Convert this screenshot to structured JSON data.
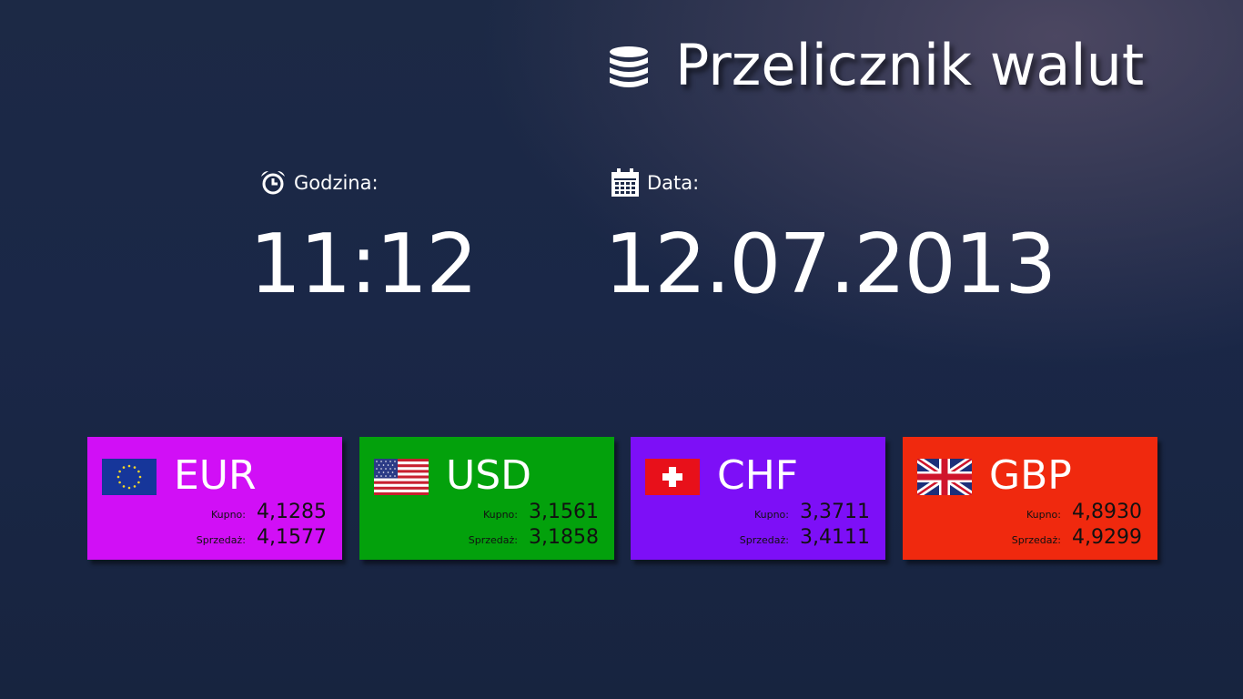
{
  "app": {
    "title": "Przelicznik walut",
    "title_icon": "database-icon"
  },
  "clock": {
    "label": "Godzina:",
    "icon": "alarm-clock-icon",
    "value": "11:12"
  },
  "calendar": {
    "label": "Data:",
    "icon": "calendar-icon",
    "value": "12.07.2013"
  },
  "currencies": [
    {
      "code": "EUR",
      "flag_icon": "eu-flag-icon",
      "color": "#d10ff6",
      "buy_label": "Kupno:",
      "buy": "4,1285",
      "sell_label": "Sprzedaż:",
      "sell": "4,1577"
    },
    {
      "code": "USD",
      "flag_icon": "us-flag-icon",
      "color": "#03a10c",
      "buy_label": "Kupno:",
      "buy": "3,1561",
      "sell_label": "Sprzedaż:",
      "sell": "3,1858"
    },
    {
      "code": "CHF",
      "flag_icon": "swiss-flag-icon",
      "color": "#7d0ff7",
      "buy_label": "Kupno:",
      "buy": "3,3711",
      "sell_label": "Sprzedaż:",
      "sell": "3,4111"
    },
    {
      "code": "GBP",
      "flag_icon": "uk-flag-icon",
      "color": "#f0290e",
      "buy_label": "Kupno:",
      "buy": "4,8930",
      "sell_label": "Sprzedaż:",
      "sell": "4,9299"
    }
  ]
}
